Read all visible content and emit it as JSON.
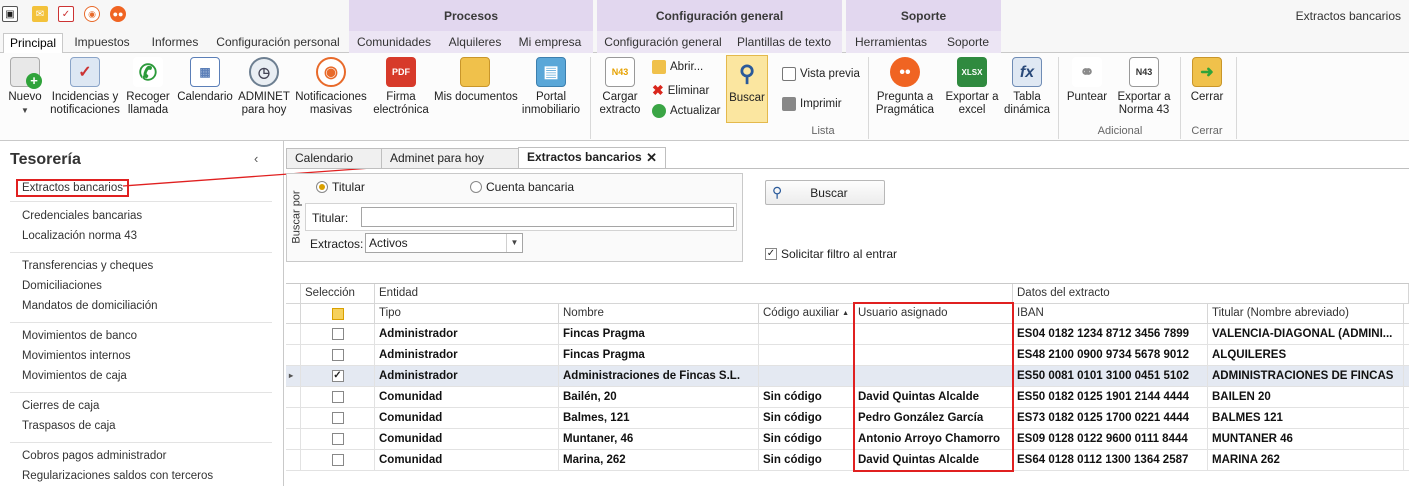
{
  "app": {
    "title": "Extractos bancarios"
  },
  "context_groups": [
    "Procesos",
    "Configuración general",
    "Soporte"
  ],
  "tabs": [
    "Principal",
    "Impuestos",
    "Informes",
    "Configuración personal",
    "Comunidades",
    "Alquileres",
    "Mi empresa",
    "Configuración general",
    "Plantillas de texto",
    "Herramientas",
    "Soporte"
  ],
  "ribbon": {
    "nuevo": "Nuevo",
    "incidencias": "Incidencias y notificaciones",
    "recoger": "Recoger llamada",
    "calendario": "Calendario",
    "adminet": "ADMINET para hoy",
    "notificaciones": "Notificaciones masivas",
    "firma": "Firma electrónica",
    "mis_documentos": "Mis documentos",
    "portal": "Portal inmobiliario",
    "cargar": "Cargar extracto",
    "abrir": "Abrir...",
    "eliminar": "Eliminar",
    "actualizar": "Actualizar",
    "buscar": "Buscar",
    "vista_previa": "Vista previa",
    "imprimir": "Imprimir",
    "group_lista": "Lista",
    "pregunta": "Pregunta a Pragmática",
    "exportar_excel": "Exportar a excel",
    "tabla_dinamica": "Tabla dinámica",
    "puntear": "Puntear",
    "exportar_n43": "Exportar a Norma 43",
    "group_adicional": "Adicional",
    "cerrar": "Cerrar",
    "group_cerrar": "Cerrar",
    "pdf_badge": "PDF",
    "n43_badge": "N43",
    "xlsx_badge": "XLSX"
  },
  "sidebar": {
    "title": "Tesorería",
    "items": [
      "Extractos bancarios",
      "Credenciales bancarias",
      "Localización norma 43",
      "Transferencias y cheques",
      "Domiciliaciones",
      "Mandatos de domiciliación",
      "Movimientos de banco",
      "Movimientos internos",
      "Movimientos de caja",
      "Cierres de caja",
      "Traspasos de caja",
      "Cobros pagos administrador",
      "Regularizaciones saldos con terceros"
    ]
  },
  "doc_tabs": [
    "Calendario",
    "Adminet para hoy",
    "Extractos bancarios"
  ],
  "filter": {
    "group_label": "Buscar por",
    "radio_titular": "Titular",
    "radio_cuenta": "Cuenta bancaria",
    "titular_label": "Titular:",
    "titular_value": "",
    "extractos_label": "Extractos:",
    "extractos_value": "Activos",
    "buscar_button": "Buscar",
    "solicitar_filtro": "Solicitar filtro al entrar"
  },
  "grid": {
    "band_headers": [
      "Selección",
      "Entidad",
      "Datos del extracto"
    ],
    "columns": [
      "Tipo",
      "Nombre",
      "Código auxiliar",
      "Usuario asignado",
      "IBAN",
      "Titular (Nombre abreviado)"
    ],
    "rows": [
      {
        "tipo": "Administrador",
        "nombre": "Fincas Pragma",
        "codigo": "",
        "usuario": "",
        "iban": "ES04 0182 1234 8712 3456 7899",
        "titular": "VALENCIA-DIAGONAL (ADMINI...",
        "checked": false
      },
      {
        "tipo": "Administrador",
        "nombre": "Fincas Pragma",
        "codigo": "",
        "usuario": "",
        "iban": "ES48 2100 0900 9734 5678 9012",
        "titular": "ALQUILERES",
        "checked": false
      },
      {
        "tipo": "Administrador",
        "nombre": "Administraciones de Fincas S.L.",
        "codigo": "",
        "usuario": "",
        "iban": "ES50 0081 0101 3100 0451 5102",
        "titular": "ADMINISTRACIONES DE FINCAS",
        "checked": true
      },
      {
        "tipo": "Comunidad",
        "nombre": "Bailén, 20",
        "codigo": "Sin código",
        "usuario": "David Quintas Alcalde",
        "iban": "ES50 0182 0125 1901 2144 4444",
        "titular": "BAILEN 20",
        "checked": false
      },
      {
        "tipo": "Comunidad",
        "nombre": "Balmes, 121",
        "codigo": "Sin código",
        "usuario": "Pedro González García",
        "iban": "ES73 0182 0125 1700 0221 4444",
        "titular": "BALMES 121",
        "checked": false
      },
      {
        "tipo": "Comunidad",
        "nombre": "Muntaner, 46",
        "codigo": "Sin código",
        "usuario": "Antonio Arroyo Chamorro",
        "iban": "ES09 0128 0122 9600 0111 8444",
        "titular": "MUNTANER 46",
        "checked": false
      },
      {
        "tipo": "Comunidad",
        "nombre": "Marina, 262",
        "codigo": "Sin código",
        "usuario": "David Quintas Alcalde",
        "iban": "ES64 0128 0112 1300 1364 2587",
        "titular": "MARINA 262",
        "checked": false
      }
    ]
  }
}
